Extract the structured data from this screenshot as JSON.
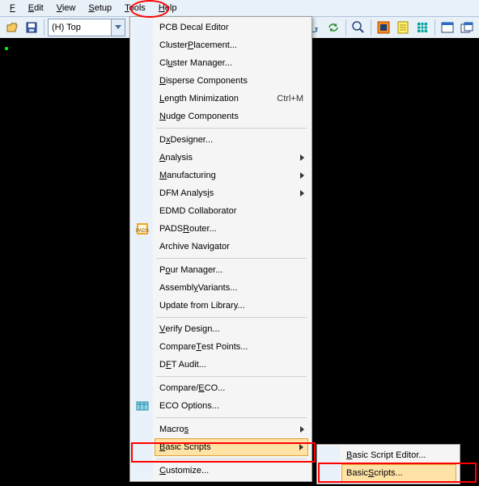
{
  "menubar": {
    "file": "File",
    "edit": "Edit",
    "view": "View",
    "setup": "Setup",
    "tools": "Tools",
    "help": "Help"
  },
  "toolbar": {
    "layer_combo": "(H) Top"
  },
  "tools_menu": {
    "pcb_decal_editor": "PCB Decal Editor",
    "cluster_placement": "Cluster Placement...",
    "cluster_manager": "Cluster Manager...",
    "disperse_components": "Disperse Components",
    "length_minimization": "Length Minimization",
    "length_minimization_shortcut": "Ctrl+M",
    "nudge_components": "Nudge Components",
    "dxdesigner": "DxDesigner...",
    "analysis": "Analysis",
    "manufacturing": "Manufacturing",
    "dfm_analysis": "DFM Analysis",
    "edmd_collaborator": "EDMD Collaborator",
    "pads_router": "PADS Router...",
    "archive_navigator": "Archive Navigator",
    "pour_manager": "Pour Manager...",
    "assembly_variants": "Assembly Variants...",
    "update_from_library": "Update from Library...",
    "verify_design": "Verify Design...",
    "compare_test_points": "Compare Test Points...",
    "dft_audit": "DFT Audit...",
    "compare_eco": "Compare/ECO...",
    "eco_options": "ECO Options...",
    "macros": "Macros",
    "basic_scripts": "Basic Scripts",
    "customize": "Customize..."
  },
  "submenu": {
    "basic_script_editor": "Basic Script Editor...",
    "basic_scripts": "Basic Scripts..."
  }
}
